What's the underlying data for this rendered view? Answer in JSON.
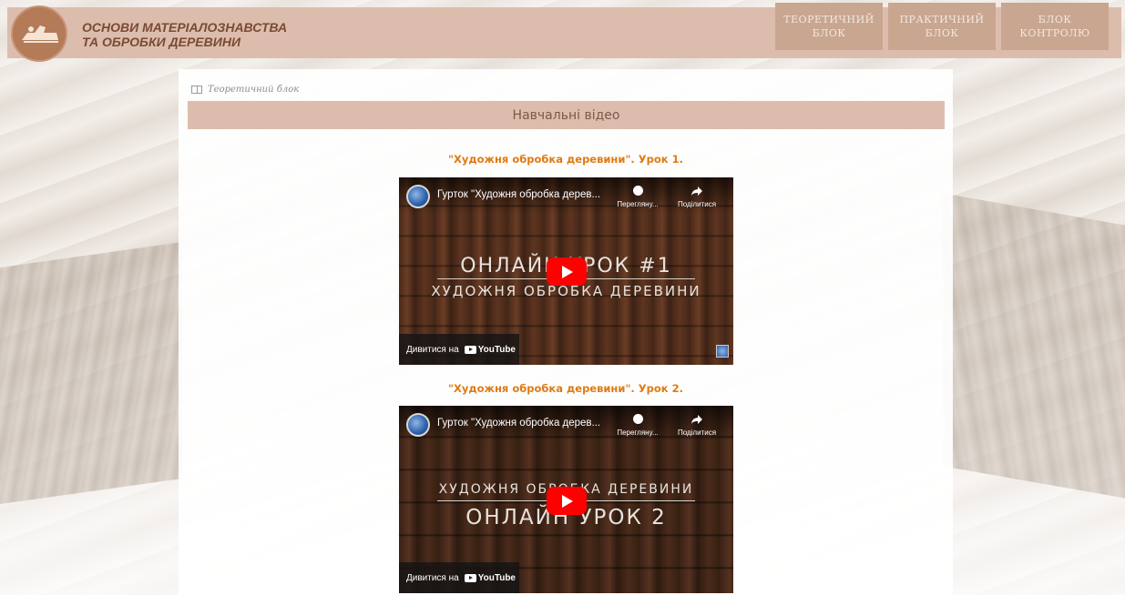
{
  "site": {
    "title_line1": "ОСНОВИ МАТЕРІАЛОЗНАВСТВА",
    "title_line2": "ТА ОБРОБКИ ДЕРЕВИНИ"
  },
  "nav": [
    {
      "line1": "ТЕОРЕТИЧНИЙ",
      "line2": "БЛОК"
    },
    {
      "line1": "ПРАКТИЧНИЙ",
      "line2": "БЛОК"
    },
    {
      "line1": "БЛОК",
      "line2": "КОНТРОЛЮ"
    }
  ],
  "breadcrumb": "Теоретичний блок",
  "section_title": "Навчальні відео",
  "videos": [
    {
      "heading": "\"Художня обробка деревини\". Урок 1.",
      "caption": "Гурток \"Художня обробка дерев...",
      "watch_later": "Переглянy...",
      "share": "Поділитися",
      "overlay_line1": "ОНЛАЙН УРОК #1",
      "overlay_line2": "ХУДОЖНЯ ОБРОБКА ДЕРЕВИНИ",
      "watch_on": "Дивитися на",
      "yt": "YouTube"
    },
    {
      "heading": "\"Художня обробка деревини\". Урок 2.",
      "caption": "Гурток \"Художня обробка дерев...",
      "watch_later": "Переглянy...",
      "share": "Поділитися",
      "overlay_line1": "ХУДОЖНЯ ОБРОБКА ДЕРЕВИНИ",
      "overlay_line2": "ОНЛАЙН УРОК 2",
      "watch_on": "Дивитися на",
      "yt": "YouTube"
    }
  ],
  "colors": {
    "header_bg": "#dcbdad",
    "nav_bg": "#c9a690",
    "title_text": "#7a4a33",
    "video_heading": "#e07a12",
    "play_button": "#ff0000"
  }
}
